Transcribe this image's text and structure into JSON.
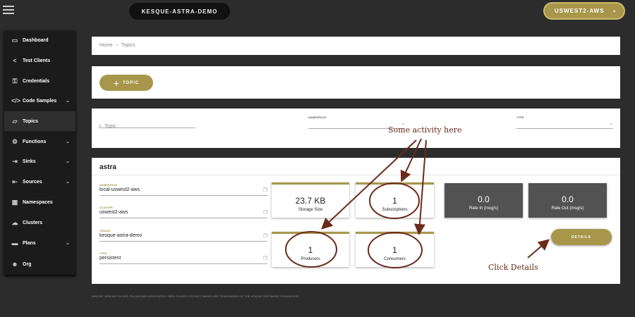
{
  "header": {
    "database": "KESQUE-ASTRA-DEMO",
    "region": "USWEST2-AWS"
  },
  "sidebar": {
    "items": [
      {
        "label": "Dashboard",
        "icon": "monitor-icon"
      },
      {
        "label": "Test Clients",
        "icon": "share-icon"
      },
      {
        "label": "Credentials",
        "icon": "key-icon"
      },
      {
        "label": "Code Samples",
        "icon": "code-icon"
      },
      {
        "label": "Topics",
        "icon": "folder-icon"
      },
      {
        "label": "Functions",
        "icon": "gears-icon"
      },
      {
        "label": "Sinks",
        "icon": "sink-icon"
      },
      {
        "label": "Sources",
        "icon": "login-icon"
      },
      {
        "label": "Namespaces",
        "icon": "grid-icon"
      },
      {
        "label": "Clusters",
        "icon": "cloud-icon"
      },
      {
        "label": "Plans",
        "icon": "card-icon"
      },
      {
        "label": "Org",
        "icon": "users-icon"
      }
    ]
  },
  "breadcrumb": {
    "home": "Home",
    "separator": "›",
    "current": "Topics"
  },
  "topic_button": "TOPIC",
  "filters": {
    "topic_placeholder": "Topic",
    "namespace_label": "NAMESPACE",
    "type_label": "TYPE"
  },
  "topic": {
    "name": "astra",
    "fields": [
      {
        "label": "NAMESPACE",
        "value": "local-uswest2-aws"
      },
      {
        "label": "CLUSTER",
        "value": "uswest2-aws"
      },
      {
        "label": "TENANT",
        "value": "kesque-astra-demo"
      },
      {
        "label": "TYPE",
        "value": "persistent"
      }
    ],
    "stats": {
      "storage": {
        "value": "23.7 KB",
        "label": "Storage Size"
      },
      "subscriptions": {
        "value": "1",
        "label": "Subscriptions"
      },
      "rate_in": {
        "value": "0.0",
        "label": "Rate In (msg/s)"
      },
      "rate_out": {
        "value": "0.0",
        "label": "Rate Out (msg/s)"
      },
      "producers": {
        "value": "1",
        "label": "Producers"
      },
      "consumers": {
        "value": "1",
        "label": "Consumers"
      }
    },
    "details_button": "DETAILS"
  },
  "annotations": {
    "activity": "Some activity here",
    "details": "Click Details"
  },
  "footer": "APACHE, APACHE PULSAR, PULSAR AND ASSOCIATED OPEN SOURCE PROJECT NAMES ARE TRADEMARKS OF THE APACHE SOFTWARE FOUNDATION",
  "colors": {
    "accent": "#a8974b",
    "annotation": "#6b2a1a",
    "background": "#2c2c2c"
  }
}
